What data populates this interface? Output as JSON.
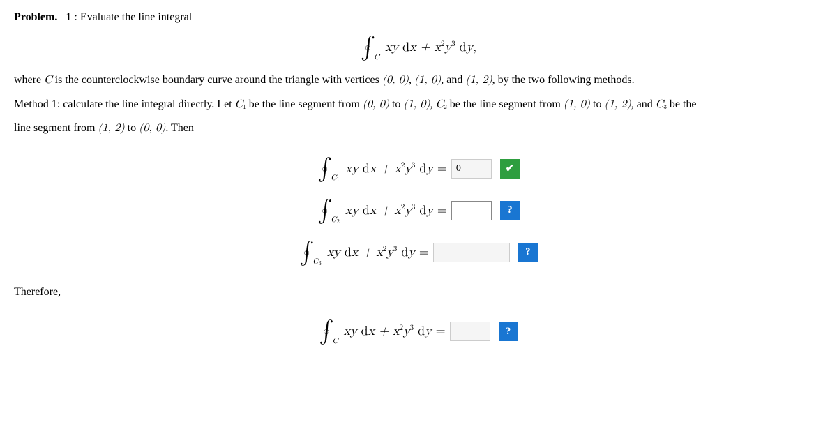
{
  "header": {
    "label": "Problem.",
    "number": "1 :",
    "intro": "Evaluate the line integral"
  },
  "mainIntegral": {
    "sub": "C",
    "expr": "xy dx + x²y³ dy,"
  },
  "description": {
    "line1_pre": "where ",
    "line1_C": "C",
    "line1_mid": " is the counterclockwise boundary curve around the triangle with vertices ",
    "v1": "(0, 0)",
    "v2": "(1, 0)",
    "v3": "(1, 2)",
    "line1_end": ", by the two following methods.",
    "line2_pre": "Method 1: calculate the line integral directly. Let ",
    "c1": "C₁",
    "line2_a": " be the line segment from ",
    "p00": "(0, 0)",
    "line2_to": " to ",
    "p10": "(1, 0)",
    "line2_b": ", ",
    "c2": "C₂",
    "line2_c": " be the line segment from ",
    "p10b": "(1, 0)",
    "p12": "(1, 2)",
    "line2_d": ", and ",
    "c3": "C₃",
    "line2_e": " be the",
    "line3": "line segment from ",
    "p12b": "(1, 2)",
    "p00b": "(0, 0)",
    "line3_end": ". Then"
  },
  "rows": [
    {
      "sub": "C",
      "subnum": "1",
      "value": "0",
      "status": "correct",
      "inputClass": "",
      "wide": false
    },
    {
      "sub": "C",
      "subnum": "2",
      "value": "",
      "status": "pending",
      "inputClass": "active",
      "wide": false
    },
    {
      "sub": "C",
      "subnum": "3",
      "value": "",
      "status": "pending",
      "inputClass": "",
      "wide": true
    },
    {
      "sub": "C",
      "subnum": "",
      "value": "",
      "status": "pending",
      "inputClass": "",
      "wide": false
    }
  ],
  "integrand": "xy dx + x²y³ dy =",
  "therefore": "Therefore,",
  "icons": {
    "check": "✔",
    "question": "?"
  }
}
